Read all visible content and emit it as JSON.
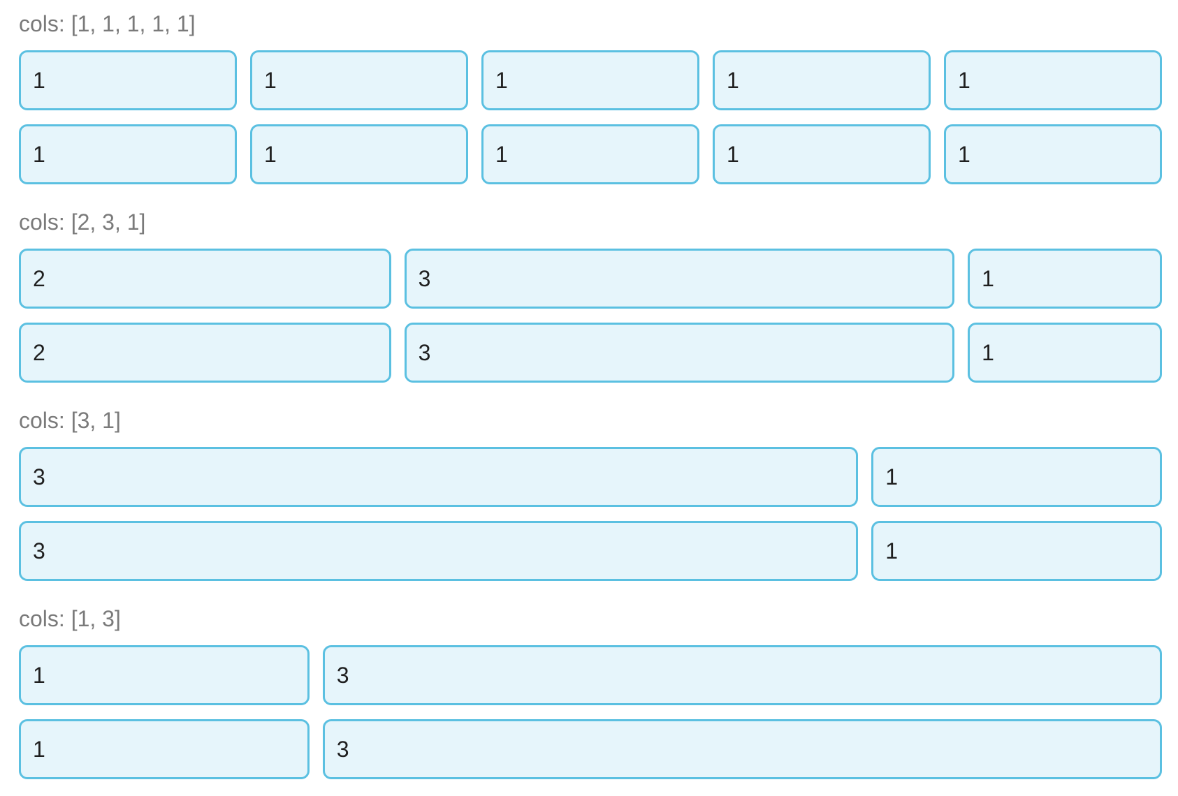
{
  "sections": [
    {
      "label": "cols: [1, 1, 1, 1, 1]",
      "cols": [
        1,
        1,
        1,
        1,
        1
      ],
      "rows": [
        [
          "1",
          "1",
          "1",
          "1",
          "1"
        ],
        [
          "1",
          "1",
          "1",
          "1",
          "1"
        ]
      ]
    },
    {
      "label": "cols: [2, 3, 1]",
      "cols": [
        2,
        3,
        1
      ],
      "rows": [
        [
          "2",
          "3",
          "1"
        ],
        [
          "2",
          "3",
          "1"
        ]
      ]
    },
    {
      "label": "cols: [3, 1]",
      "cols": [
        3,
        1
      ],
      "rows": [
        [
          "3",
          "1"
        ],
        [
          "3",
          "1"
        ]
      ]
    },
    {
      "label": "cols: [1, 3]",
      "cols": [
        1,
        3
      ],
      "rows": [
        [
          "1",
          "3"
        ],
        [
          "1",
          "3"
        ]
      ]
    }
  ],
  "colors": {
    "cell_border": "#5bc0e1",
    "cell_background": "#e6f5fb",
    "label_text": "#7a7a7a",
    "cell_text": "#1f1f1f"
  }
}
